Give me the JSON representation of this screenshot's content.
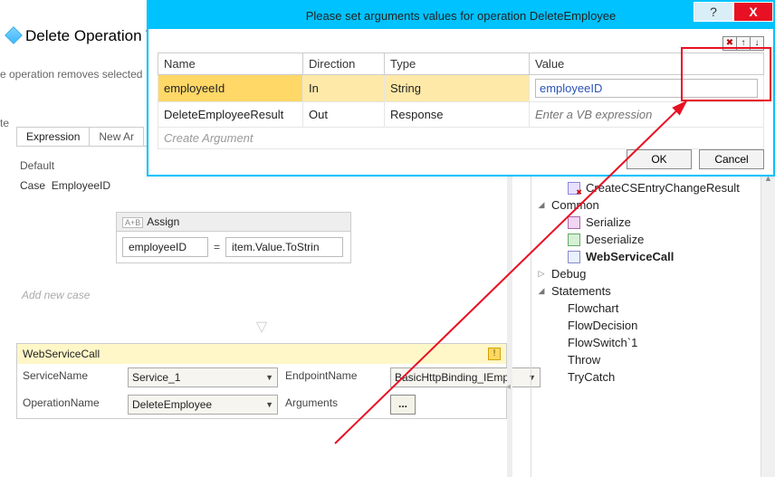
{
  "page": {
    "title": "Delete Operation Wo",
    "desc": "e operation removes selected",
    "breadcrumbEnd": "te"
  },
  "tabs": {
    "expression": "Expression",
    "newArg": "New Ar"
  },
  "switchBlock": {
    "defaultLabel": "Default",
    "caseLabel": "Case",
    "caseValue": "EmployeeID",
    "addCase": "Add new case"
  },
  "assign": {
    "header": "Assign",
    "tag": "A+B",
    "left": "employeeID",
    "eq": "=",
    "right": "item.Value.ToStrin"
  },
  "wsc": {
    "header": "WebServiceCall",
    "serviceNameLbl": "ServiceName",
    "serviceNameVal": "Service_1",
    "endpointLbl": "EndpointName",
    "endpointVal": "BasicHttpBinding_IEmployeeService",
    "operationLbl": "OperationName",
    "operationVal": "DeleteEmployee",
    "argumentsLbl": "Arguments",
    "dots": "..."
  },
  "sidebar": {
    "items": [
      {
        "label": "CreateCSEntryChangeResult"
      },
      {
        "label": "Common",
        "expand": true
      },
      {
        "label": "Serialize"
      },
      {
        "label": "Deserialize"
      },
      {
        "label": "WebServiceCall",
        "bold": true
      },
      {
        "label": "Debug",
        "collapsed": true
      },
      {
        "label": "Statements",
        "expand": true
      },
      {
        "label": "Flowchart"
      },
      {
        "label": "FlowDecision"
      },
      {
        "label": "FlowSwitch`1"
      },
      {
        "label": "Throw"
      },
      {
        "label": "TryCatch"
      }
    ]
  },
  "dialog": {
    "title": "Please set arguments values for operation DeleteEmployee",
    "help": "?",
    "close": "X",
    "tools": {
      "del": "✖",
      "up": "↑",
      "down": "↓"
    },
    "columns": {
      "name": "Name",
      "direction": "Direction",
      "type": "Type",
      "value": "Value"
    },
    "rows": [
      {
        "name": "employeeId",
        "direction": "In",
        "type": "String",
        "value": "employeeID"
      },
      {
        "name": "DeleteEmployeeResult",
        "direction": "Out",
        "type": "Response",
        "placeholder": "Enter a VB expression"
      }
    ],
    "createArgument": "Create Argument",
    "ok": "OK",
    "cancel": "Cancel"
  }
}
